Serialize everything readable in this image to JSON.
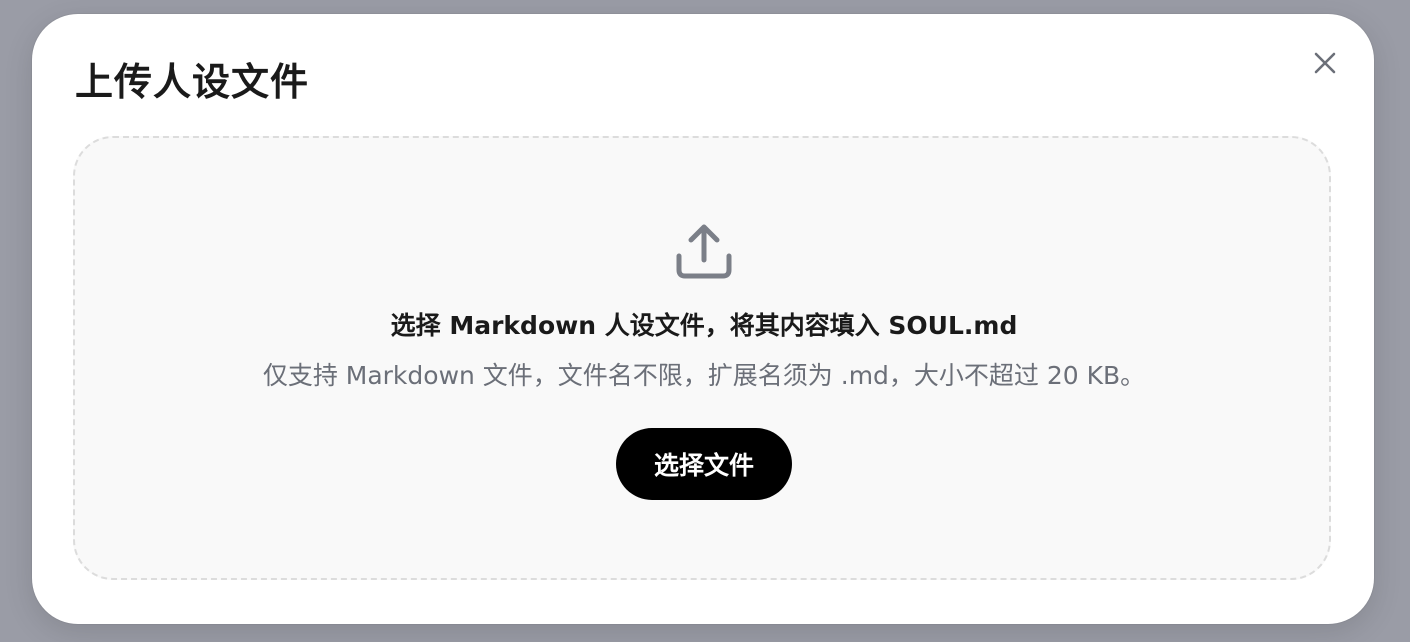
{
  "dialog": {
    "title": "上传人设文件",
    "close_icon": "close-icon"
  },
  "dropzone": {
    "icon": "upload-icon",
    "primary_text": "选择 Markdown 人设文件，将其内容填入 SOUL.md",
    "secondary_text": "仅支持 Markdown 文件，文件名不限，扩展名须为 .md，大小不超过 20 KB。",
    "button_label": "选择文件"
  },
  "colors": {
    "backdrop": "#9a9ca6",
    "dialog_bg": "#ffffff",
    "dropzone_bg": "#f9f9f9",
    "dropzone_border": "#dcdcdc",
    "button_bg": "#000000",
    "button_text": "#ffffff",
    "icon_gray": "#7b7f88",
    "secondary_text": "#6b6f78"
  }
}
